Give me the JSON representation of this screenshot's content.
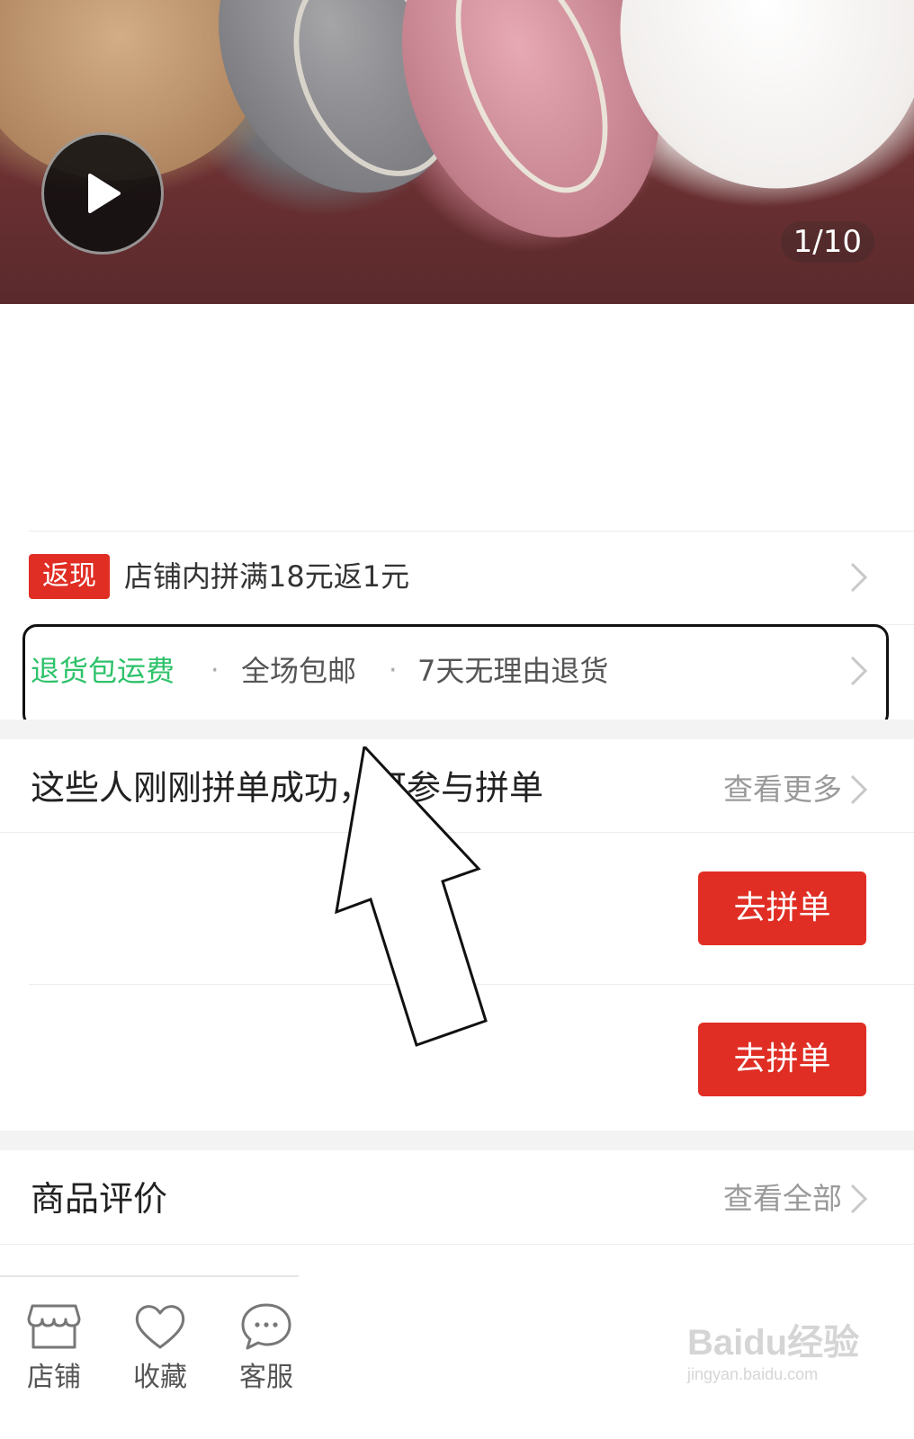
{
  "hero": {
    "counter": "1/10",
    "play_icon": "play-icon"
  },
  "promo": {
    "badge": "返现",
    "text": "店铺内拼满18元返1元"
  },
  "services": {
    "items": [
      "退货包运费",
      "全场包邮",
      "7天无理由退货"
    ],
    "separator": "·",
    "highlight_color": "#2ec26a"
  },
  "group_buy": {
    "title": "这些人刚刚拼单成功，可参与拼单",
    "more_label": "查看更多",
    "join_buttons": [
      "去拼单",
      "去拼单"
    ]
  },
  "reviews": {
    "title": "商品评价",
    "more_label": "查看全部"
  },
  "bottom_bar": {
    "items": [
      {
        "label": "店铺",
        "icon": "store-icon"
      },
      {
        "label": "收藏",
        "icon": "heart-icon"
      },
      {
        "label": "客服",
        "icon": "chat-bubble-icon"
      }
    ]
  },
  "watermark": {
    "brand": "Baidu经验",
    "url": "jingyan.baidu.com"
  },
  "colors": {
    "accent": "#e02e24",
    "green": "#2ec26a"
  }
}
